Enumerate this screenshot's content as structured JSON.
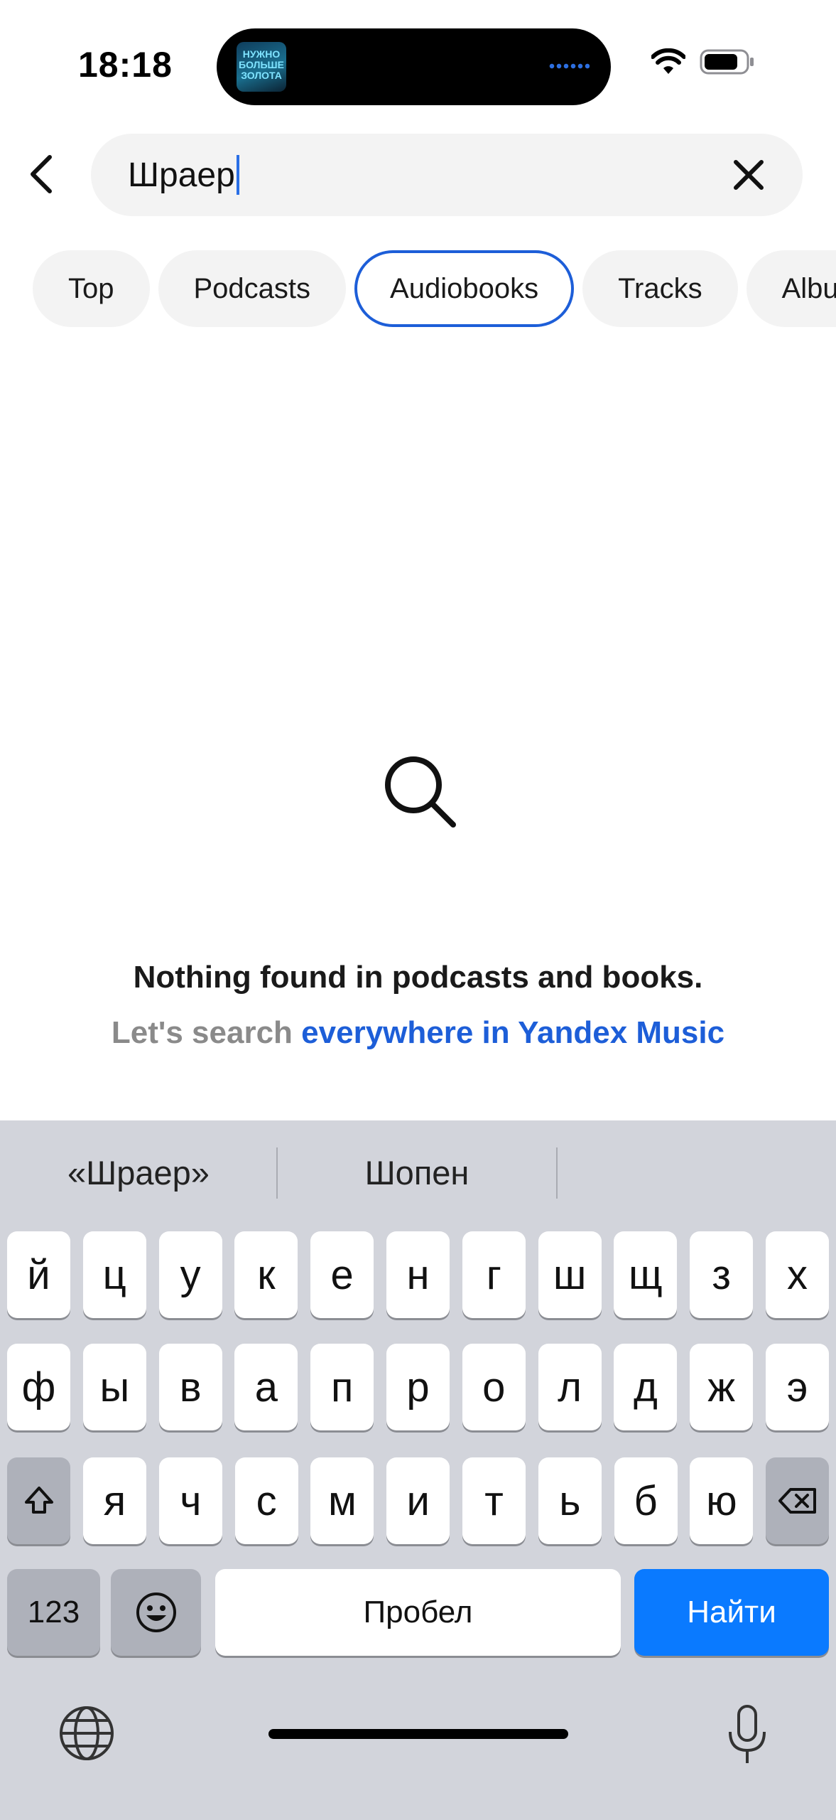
{
  "status_bar": {
    "time": "18:18",
    "now_playing_art_text": "НУЖНО БОЛЬШЕ ЗОЛОТА",
    "wifi_icon": "wifi-icon",
    "battery_icon": "battery-icon"
  },
  "search": {
    "value": "Шраер",
    "back_icon": "chevron-left-icon",
    "clear_icon": "close-icon"
  },
  "tabs": [
    {
      "label": "Top"
    },
    {
      "label": "Podcasts"
    },
    {
      "label": "Audiobooks",
      "active": true
    },
    {
      "label": "Tracks"
    },
    {
      "label": "Albums"
    }
  ],
  "empty_state": {
    "icon": "search-icon",
    "title": "Nothing found in podcasts and books.",
    "subtitle_prefix": "Let's search ",
    "subtitle_link": "everywhere in Yandex Music"
  },
  "keyboard": {
    "suggestions": [
      "«Шраер»",
      "Шопен"
    ],
    "row1": [
      "й",
      "ц",
      "у",
      "к",
      "е",
      "н",
      "г",
      "ш",
      "щ",
      "з",
      "х"
    ],
    "row2": [
      "ф",
      "ы",
      "в",
      "а",
      "п",
      "р",
      "о",
      "л",
      "д",
      "ж",
      "э"
    ],
    "row3": [
      "я",
      "ч",
      "с",
      "м",
      "и",
      "т",
      "ь",
      "б",
      "ю"
    ],
    "numbers_label": "123",
    "space_label": "Пробел",
    "go_label": "Найти",
    "accent_color": "#0A7AFF"
  },
  "colors": {
    "active_tab_border": "#1D5ED8",
    "link": "#1D5ED8",
    "keyboard_bg": "#D2D4DB"
  }
}
